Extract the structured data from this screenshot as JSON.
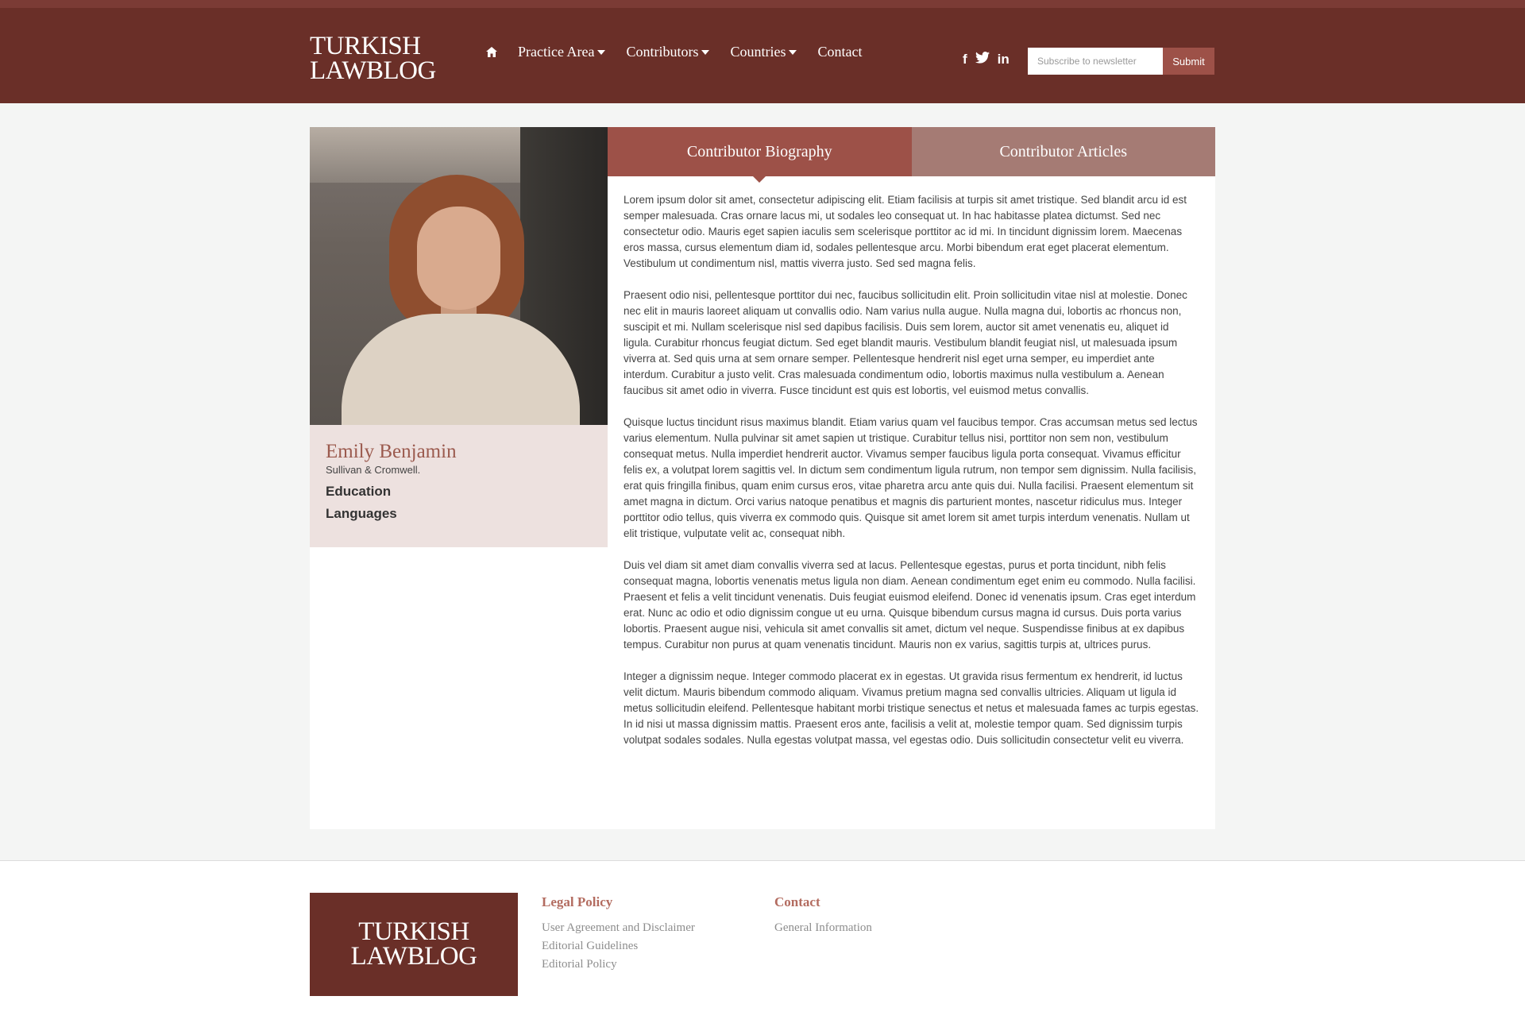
{
  "brand": {
    "logo_line1": "TURKISH",
    "logo_line2": "LAWBLOG"
  },
  "nav": {
    "home_icon": "home-icon",
    "items": [
      {
        "label": "Practice Area",
        "dropdown": true
      },
      {
        "label": "Contributors",
        "dropdown": true
      },
      {
        "label": "Countries",
        "dropdown": true
      },
      {
        "label": "Contact",
        "dropdown": false
      }
    ]
  },
  "social": {
    "facebook": "f",
    "twitter": "twitter-icon",
    "linkedin": "in"
  },
  "newsletter": {
    "placeholder": "Subscribe to newsletter",
    "submit_label": "Submit"
  },
  "profile": {
    "name": "Emily Benjamin",
    "firm": "Sullivan & Cromwell.",
    "links": [
      "Education",
      "Languages"
    ]
  },
  "tabs": [
    {
      "label": "Contributor Biography",
      "active": true
    },
    {
      "label": "Contributor Articles",
      "active": false
    }
  ],
  "biography": [
    "Lorem ipsum dolor sit amet, consectetur adipiscing elit. Etiam facilisis at turpis sit amet tristique. Sed blandit arcu id est semper malesuada. Cras ornare lacus mi, ut sodales leo consequat ut. In hac habitasse platea dictumst. Sed nec consectetur odio. Mauris eget sapien iaculis sem scelerisque porttitor ac id mi. In tincidunt dignissim lorem. Maecenas eros massa, cursus elementum diam id, sodales pellentesque arcu. Morbi bibendum erat eget placerat elementum. Vestibulum ut condimentum nisl, mattis viverra justo. Sed sed magna felis.",
    "Praesent odio nisi, pellentesque porttitor dui nec, faucibus sollicitudin elit. Proin sollicitudin vitae nisl at molestie. Donec nec elit in mauris laoreet aliquam ut convallis odio. Nam varius nulla augue. Nulla magna dui, lobortis ac rhoncus non, suscipit et mi. Nullam scelerisque nisl sed dapibus facilisis. Duis sem lorem, auctor sit amet venenatis eu, aliquet id ligula. Curabitur rhoncus feugiat dictum. Sed eget blandit mauris. Vestibulum blandit feugiat nisl, ut malesuada ipsum viverra at. Sed quis urna at sem ornare semper. Pellentesque hendrerit nisl eget urna semper, eu imperdiet ante interdum. Curabitur a justo velit. Cras malesuada condimentum odio, lobortis maximus nulla vestibulum a. Aenean faucibus sit amet odio in viverra. Fusce tincidunt est quis est lobortis, vel euismod metus convallis.",
    "Quisque luctus tincidunt risus maximus blandit. Etiam varius quam vel faucibus tempor. Cras accumsan metus sed lectus varius elementum. Nulla pulvinar sit amet sapien ut tristique. Curabitur tellus nisi, porttitor non sem non, vestibulum consequat metus. Nulla imperdiet hendrerit auctor. Vivamus semper faucibus ligula porta consequat. Vivamus efficitur felis ex, a volutpat lorem sagittis vel. In dictum sem condimentum ligula rutrum, non tempor sem dignissim. Nulla facilisis, erat quis fringilla finibus, quam enim cursus eros, vitae pharetra arcu ante quis dui. Nulla facilisi. Praesent elementum sit amet magna in dictum. Orci varius natoque penatibus et magnis dis parturient montes, nascetur ridiculus mus. Integer porttitor odio tellus, quis viverra ex commodo quis. Quisque sit amet lorem sit amet turpis interdum venenatis. Nullam ut elit tristique, vulputate velit ac, consequat nibh.",
    "Duis vel diam sit amet diam convallis viverra sed at lacus. Pellentesque egestas, purus et porta tincidunt, nibh felis consequat magna, lobortis venenatis metus ligula non diam. Aenean condimentum eget enim eu commodo. Nulla facilisi. Praesent et felis a velit tincidunt venenatis. Duis feugiat euismod eleifend. Donec id venenatis ipsum. Cras eget interdum erat. Nunc ac odio et odio dignissim congue ut eu urna. Quisque bibendum cursus magna id cursus. Duis porta varius lobortis. Praesent augue nisi, vehicula sit amet convallis sit amet, dictum vel neque. Suspendisse finibus at ex dapibus tempus. Curabitur non purus at quam venenatis tincidunt. Mauris non ex varius, sagittis turpis at, ultrices purus.",
    "Integer a dignissim neque. Integer commodo placerat ex in egestas. Ut gravida risus fermentum ex hendrerit, id luctus velit dictum. Mauris bibendum commodo aliquam. Vivamus pretium magna sed convallis ultricies. Aliquam ut ligula id metus sollicitudin eleifend. Pellentesque habitant morbi tristique senectus et netus et malesuada fames ac turpis egestas. In id nisi ut massa dignissim mattis. Praesent eros ante, facilisis a velit at, molestie tempor quam. Sed dignissim turpis volutpat sodales sodales. Nulla egestas volutpat massa, vel egestas odio. Duis sollicitudin consectetur velit eu viverra."
  ],
  "footer": {
    "logo_line1": "TURKISH",
    "logo_line2": "LAWBLOG",
    "legal": {
      "heading": "Legal Policy",
      "links": [
        "User Agreement and Disclaimer",
        "Editorial Guidelines",
        "Editorial Policy"
      ]
    },
    "contact": {
      "heading": "Contact",
      "links": [
        "General Information"
      ]
    }
  },
  "colors": {
    "header_bg": "#6a2f28",
    "accent": "#9d5148",
    "tab_inactive": "#a57b74",
    "profile_panel": "#ede1df"
  }
}
